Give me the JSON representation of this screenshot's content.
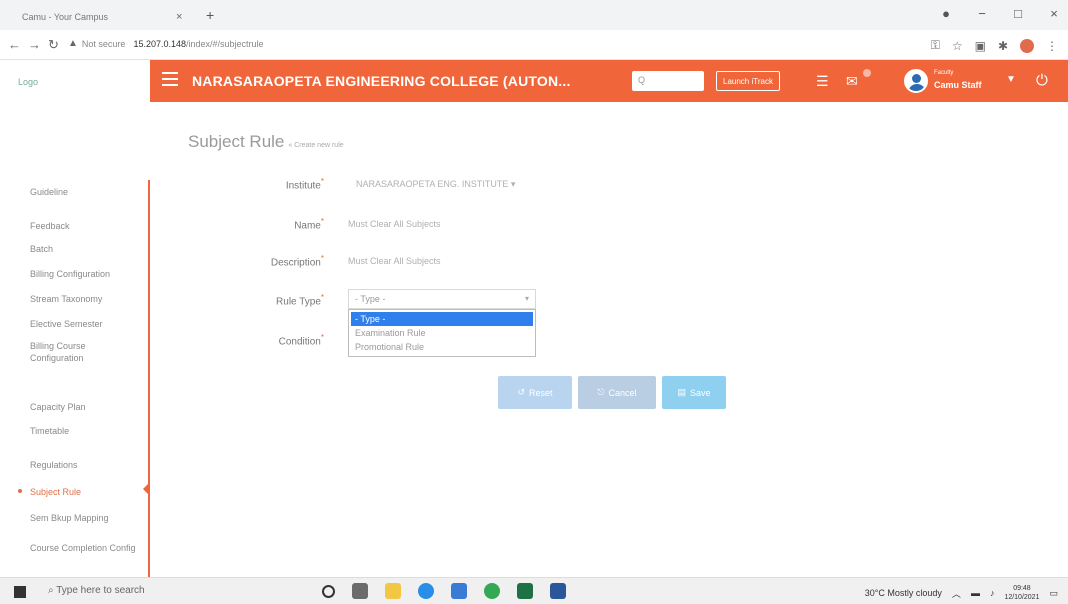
{
  "browser": {
    "tab_title": "Camu - Your Campus",
    "tab_close": "×",
    "new_tab": "+",
    "not_secure": "Not secure",
    "url_host": "15.207.0.148",
    "url_path": "/index/#/subjectrule",
    "window_min": "−",
    "window_max": "□",
    "window_close": "×"
  },
  "app": {
    "logo_text": "Logo",
    "college_name": "NARASARAOPETA ENGINEERING COLLEGE (AUTON...",
    "search_placeholder": "Q",
    "launch_button": "Launch iTrack",
    "user_role": "Faculty",
    "user_name": "Camu Staff"
  },
  "sidebar": {
    "items": [
      "Guideline",
      "Feedback",
      "Batch",
      "Billing Configuration",
      "Stream Taxonomy",
      "Elective Semester",
      "Billing Course Configuration",
      "Capacity Plan",
      "Timetable",
      "Regulations",
      "Subject Rule",
      "Sem Bkup Mapping",
      "Course Completion Config"
    ],
    "active_index": 10
  },
  "page": {
    "title": "Subject Rule",
    "subtitle": "« Create new rule"
  },
  "form": {
    "institute_label": "Institute",
    "institute_value": "NARASARAOPETA ENG. INSTITUTE",
    "name_label": "Name",
    "name_value": "Must Clear All Subjects",
    "description_label": "Description",
    "description_value": "Must Clear All Subjects",
    "rule_type_label": "Rule Type",
    "rule_type_value": "- Type -",
    "rule_type_options": [
      "- Type -",
      "Examination Rule",
      "Promotional Rule"
    ],
    "condition_label": "Condition",
    "required_mark": "*"
  },
  "buttons": {
    "reset": "Reset",
    "cancel": "Cancel",
    "save": "Save"
  },
  "taskbar": {
    "search_placeholder": "Type here to search",
    "weather": "30°C  Mostly cloudy",
    "time": "09:48",
    "date": "12/10/2021"
  }
}
